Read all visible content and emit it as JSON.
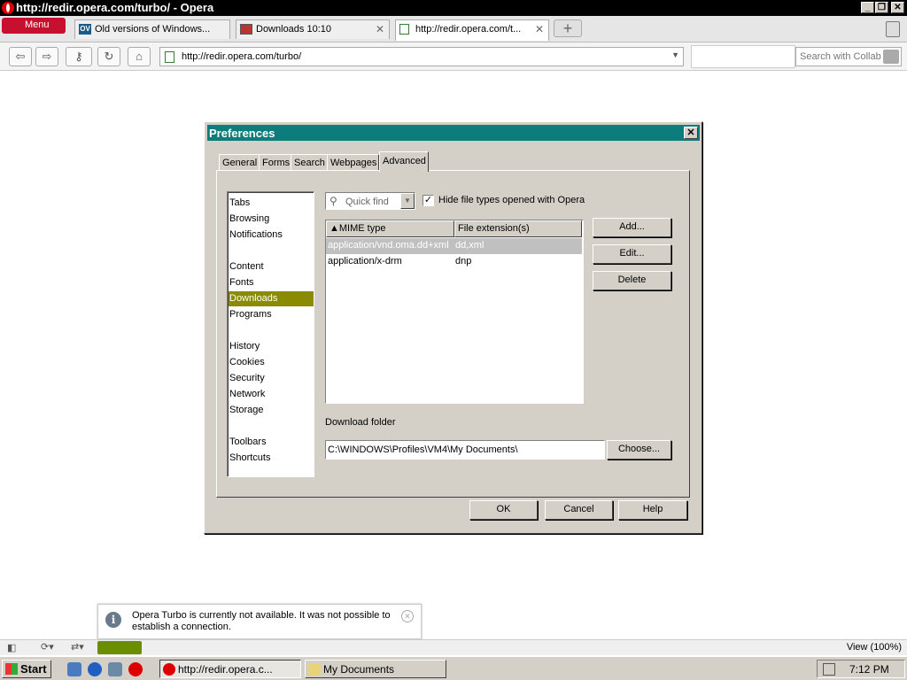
{
  "window": {
    "title": "http://redir.opera.com/turbo/ - Opera"
  },
  "browser": {
    "menu_label": "Menu",
    "tabs": [
      {
        "label": "Old versions of Windows...",
        "icon": "oldversion-favicon"
      },
      {
        "label": "Downloads 10:10",
        "icon": "downloads-page-icon"
      },
      {
        "label": "http://redir.opera.com/t...",
        "icon": "page-icon"
      }
    ],
    "address": "http://redir.opera.com/turbo/",
    "search_placeholder": "Search with Collab"
  },
  "dialog": {
    "title": "Preferences",
    "tabs": [
      "General",
      "Forms",
      "Search",
      "Webpages",
      "Advanced"
    ],
    "active_tab": "Advanced",
    "categories": [
      {
        "label": "Tabs"
      },
      {
        "label": "Browsing"
      },
      {
        "label": "Notifications"
      },
      {
        "label": "Content"
      },
      {
        "label": "Fonts"
      },
      {
        "label": "Downloads",
        "selected": true
      },
      {
        "label": "Programs"
      },
      {
        "label": "History"
      },
      {
        "label": "Cookies"
      },
      {
        "label": "Security"
      },
      {
        "label": "Network"
      },
      {
        "label": "Storage"
      },
      {
        "label": "Toolbars"
      },
      {
        "label": "Shortcuts"
      }
    ],
    "quick_find_placeholder": "Quick find",
    "hide_checkbox": {
      "label": "Hide file types opened with Opera",
      "checked": true
    },
    "table": {
      "columns": [
        "MIME type",
        "File extension(s)"
      ],
      "rows": [
        [
          "application/vnd.oma.dd+xml",
          "dd,xml"
        ],
        [
          "application/x-drm",
          "dnp"
        ]
      ]
    },
    "side_buttons": [
      "Add...",
      "Edit...",
      "Delete"
    ],
    "download_folder_label": "Download folder",
    "download_folder_value": "C:\\WINDOWS\\Profiles\\VM4\\My Documents\\",
    "choose_label": "Choose...",
    "footer_buttons": [
      "OK",
      "Cancel",
      "Help"
    ]
  },
  "notification": {
    "text": "Opera Turbo is currently not available. It was not possible to establish a connection."
  },
  "statusbar": {
    "zoom": "View (100%)"
  },
  "taskbar": {
    "start": "Start",
    "tasks": [
      "http://redir.opera.c...",
      "My Documents"
    ],
    "clock": "7:12 PM"
  },
  "colors": {
    "dialog_title": "#0d7c7c",
    "selection": "#8b8b00",
    "menu": "#c8102e"
  }
}
